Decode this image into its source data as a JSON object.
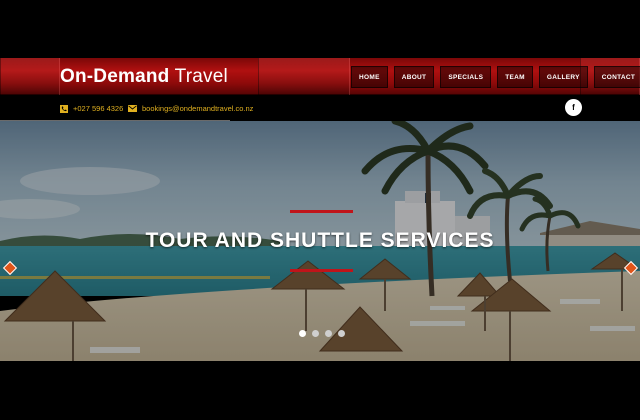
{
  "brand": {
    "name_bold": "On-Demand",
    "name_light": "Travel"
  },
  "nav": {
    "items": [
      {
        "label": "HOME"
      },
      {
        "label": "ABOUT"
      },
      {
        "label": "SPECIALS"
      },
      {
        "label": "TEAM"
      },
      {
        "label": "GALLERY"
      },
      {
        "label": "CONTACT"
      }
    ]
  },
  "contact": {
    "phone": "+027 596 4326",
    "email": "bookings@ondemandtravel.co.nz"
  },
  "social": {
    "facebook_label": "f"
  },
  "hero": {
    "title": "TOUR AND SHUTTLE SERVICES",
    "slide_count": 4,
    "active_slide": 1
  },
  "colors": {
    "brand_red": "#b01010",
    "accent_gold": "#e0b020",
    "arrow_orange": "#e0551a",
    "deco_red": "#c0141a"
  },
  "icons": {
    "phone": "phone-icon",
    "email": "envelope-icon",
    "prev": "chevron-left-icon",
    "next": "chevron-right-icon"
  }
}
